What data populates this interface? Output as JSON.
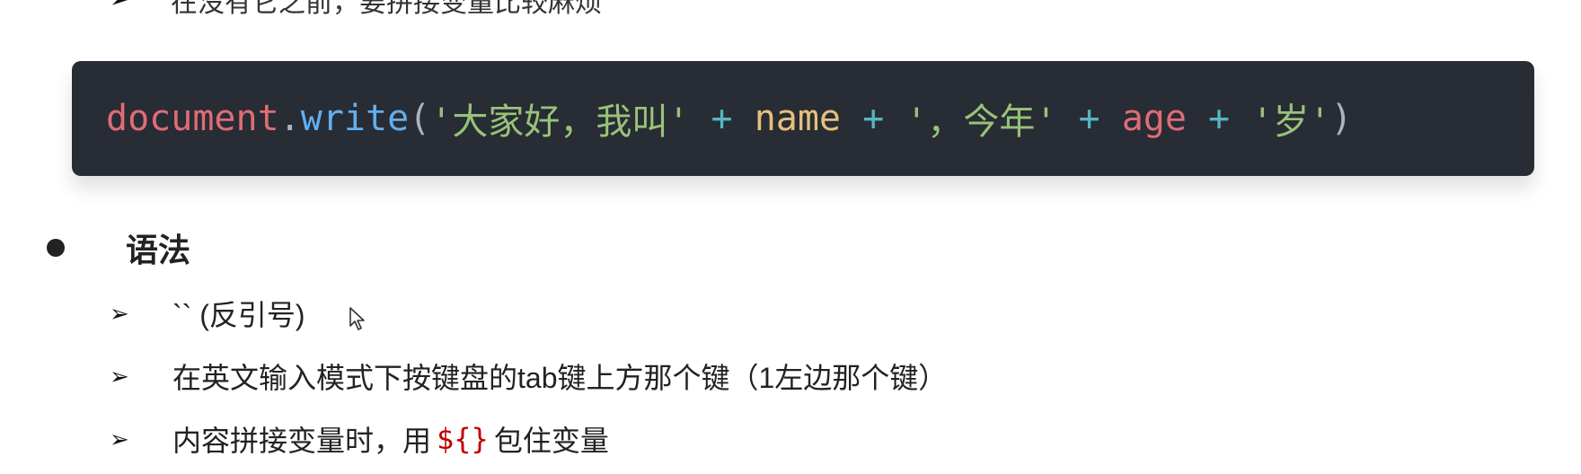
{
  "top_fragment": {
    "arrow": "➢",
    "text": "在没有它之前，要拼接变量比较麻烦"
  },
  "code": {
    "tokens": [
      {
        "cls": "tok-doc",
        "text": "document"
      },
      {
        "cls": "tok-dot",
        "text": "."
      },
      {
        "cls": "tok-fn",
        "text": "write"
      },
      {
        "cls": "tok-punc",
        "text": "("
      },
      {
        "cls": "tok-str",
        "text": "'大家好，我叫'"
      },
      {
        "cls": "tok-op",
        "text": " + "
      },
      {
        "cls": "tok-var",
        "text": "name"
      },
      {
        "cls": "tok-op",
        "text": " + "
      },
      {
        "cls": "tok-str",
        "text": "'，今年'"
      },
      {
        "cls": "tok-op",
        "text": " + "
      },
      {
        "cls": "tok-var2",
        "text": "age"
      },
      {
        "cls": "tok-op",
        "text": " + "
      },
      {
        "cls": "tok-str",
        "text": "'岁'"
      },
      {
        "cls": "tok-punc",
        "text": ")"
      }
    ]
  },
  "section": {
    "title": "语法"
  },
  "items": [
    {
      "arrow": "➢",
      "text": "`` (反引号)"
    },
    {
      "arrow": "➢",
      "text": "在英文输入模式下按键盘的tab键上方那个键（1左边那个键）"
    },
    {
      "arrow": "➢",
      "text_before": "内容拼接变量时，用",
      "highlight": "${}",
      "text_after": "包住变量"
    }
  ],
  "colors": {
    "code_background": "#282c34",
    "highlight": "#c00000"
  }
}
